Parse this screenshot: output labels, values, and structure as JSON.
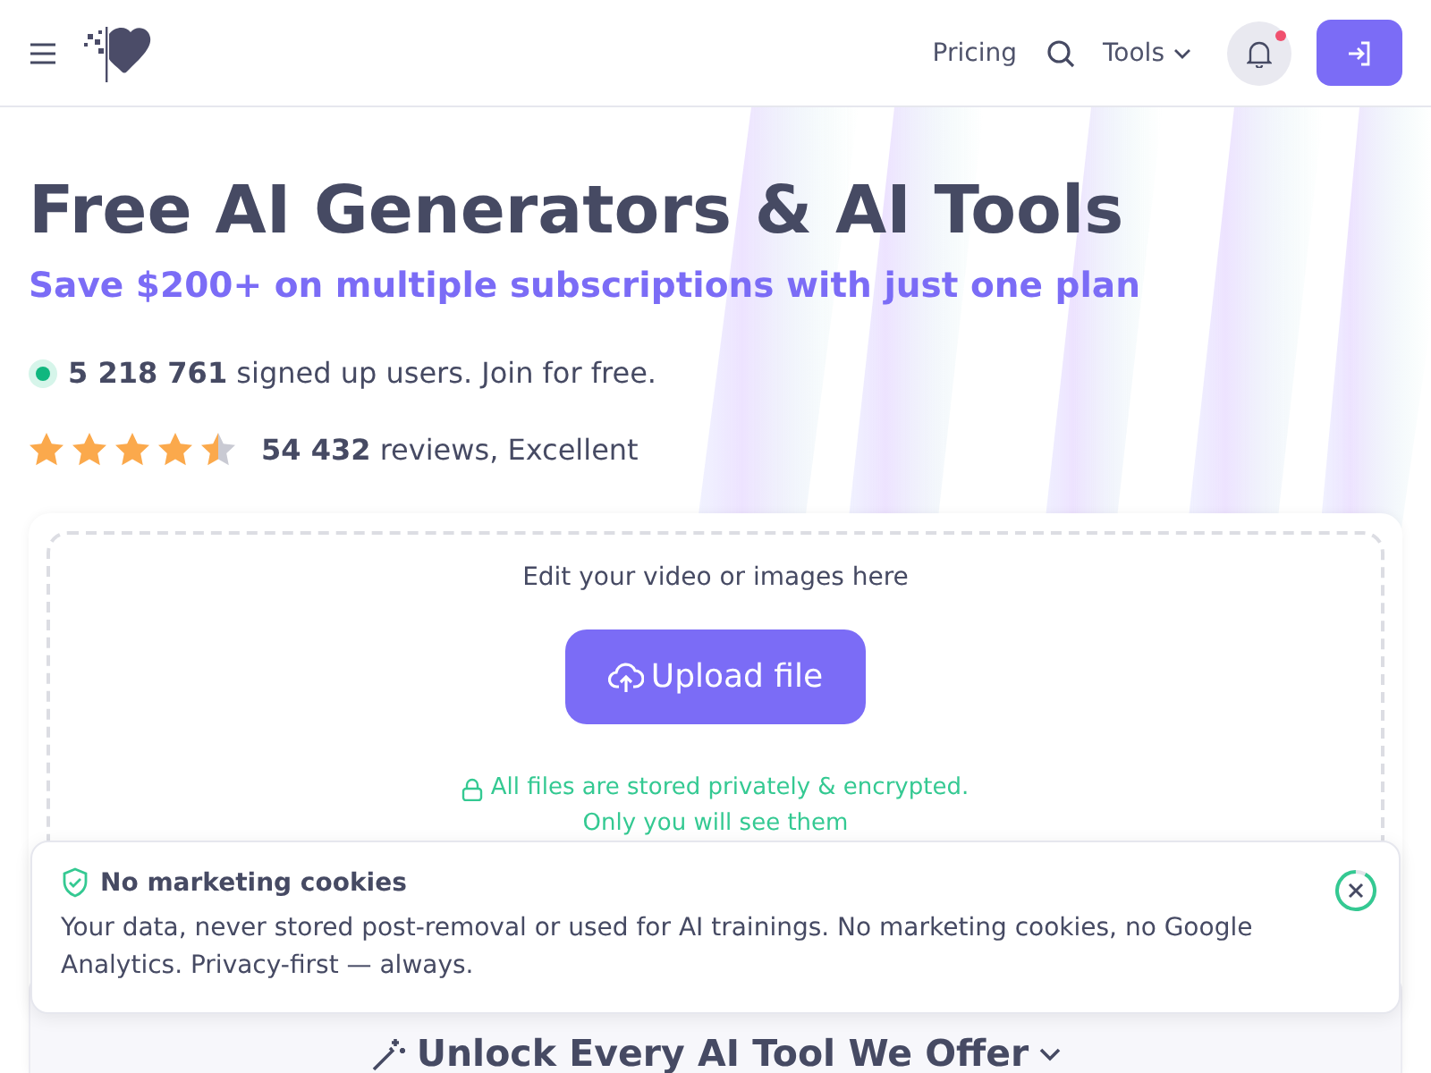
{
  "header": {
    "nav": [
      {
        "kind": "link",
        "label": "Pricing"
      },
      {
        "kind": "search"
      },
      {
        "kind": "dropdown",
        "label": "Tools"
      }
    ],
    "notification_dot": true
  },
  "hero": {
    "title": "Free AI Generators & AI Tools",
    "subtitle": "Save $200+ on multiple subscriptions with just one plan",
    "users": {
      "count": "5 218 761",
      "text": "signed up users. Join for free."
    },
    "rating": {
      "stars": 4.5,
      "count": "54 432",
      "text": "reviews, Excellent"
    }
  },
  "upload": {
    "prompt": "Edit your video or images here",
    "button": "Upload file",
    "privacy": [
      "All files are stored privately & encrypted.",
      "Only you will see them"
    ]
  },
  "section_heading": "Unlock Every AI Tool We Offer",
  "toast": {
    "title": "No marketing cookies",
    "body": "Your data, never stored post-removal or used for AI trainings. No marketing cookies, no Google Analytics. Privacy-first — always."
  }
}
